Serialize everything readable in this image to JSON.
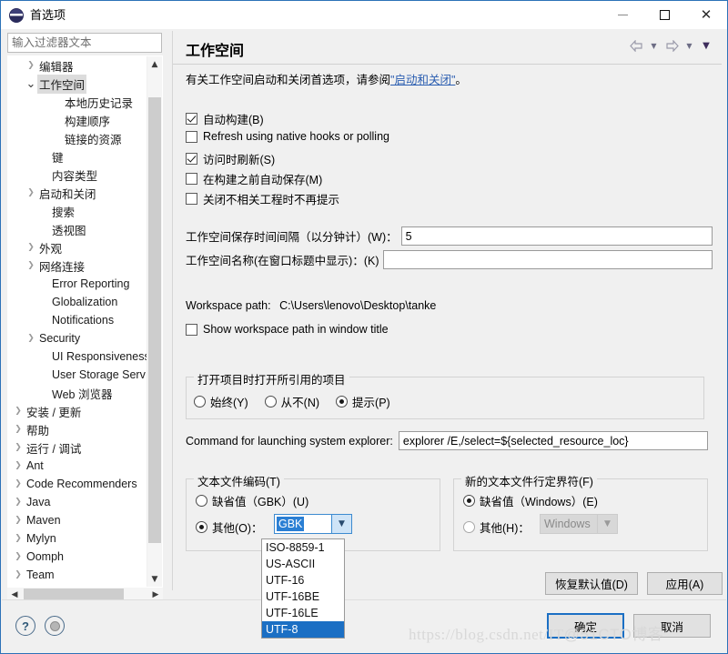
{
  "window": {
    "title": "首选项",
    "icon": "eclipse-icon",
    "controls": {
      "minimize": "—",
      "maximize": "□",
      "close": "✕"
    }
  },
  "sidebar": {
    "filter": {
      "placeholder": "输入过滤器文本",
      "value": ""
    },
    "items": [
      {
        "label": "编辑器",
        "indent": 1,
        "twisty": "collapsed",
        "selected": false
      },
      {
        "label": "工作空间",
        "indent": 1,
        "twisty": "expanded",
        "selected": true
      },
      {
        "label": "本地历史记录",
        "indent": 3,
        "twisty": "none",
        "selected": false
      },
      {
        "label": "构建顺序",
        "indent": 3,
        "twisty": "none",
        "selected": false
      },
      {
        "label": "链接的资源",
        "indent": 3,
        "twisty": "none",
        "selected": false
      },
      {
        "label": "键",
        "indent": 2,
        "twisty": "none",
        "selected": false
      },
      {
        "label": "内容类型",
        "indent": 2,
        "twisty": "none",
        "selected": false
      },
      {
        "label": "启动和关闭",
        "indent": 1,
        "twisty": "collapsed",
        "selected": false
      },
      {
        "label": "搜索",
        "indent": 2,
        "twisty": "none",
        "selected": false
      },
      {
        "label": "透视图",
        "indent": 2,
        "twisty": "none",
        "selected": false
      },
      {
        "label": "外观",
        "indent": 1,
        "twisty": "collapsed",
        "selected": false
      },
      {
        "label": "网络连接",
        "indent": 1,
        "twisty": "collapsed",
        "selected": false
      },
      {
        "label": "Error Reporting",
        "indent": 2,
        "twisty": "none",
        "selected": false
      },
      {
        "label": "Globalization",
        "indent": 2,
        "twisty": "none",
        "selected": false
      },
      {
        "label": "Notifications",
        "indent": 2,
        "twisty": "none",
        "selected": false
      },
      {
        "label": "Security",
        "indent": 1,
        "twisty": "collapsed",
        "selected": false
      },
      {
        "label": "UI Responsiveness",
        "indent": 2,
        "twisty": "none",
        "selected": false
      },
      {
        "label": "User Storage Serv",
        "indent": 2,
        "twisty": "none",
        "selected": false
      },
      {
        "label": "Web 浏览器",
        "indent": 2,
        "twisty": "none",
        "selected": false
      },
      {
        "label": "安装 / 更新",
        "indent": 0,
        "twisty": "collapsed",
        "selected": false
      },
      {
        "label": "帮助",
        "indent": 0,
        "twisty": "collapsed",
        "selected": false
      },
      {
        "label": "运行 / 调试",
        "indent": 0,
        "twisty": "collapsed",
        "selected": false
      },
      {
        "label": "Ant",
        "indent": 0,
        "twisty": "collapsed",
        "selected": false
      },
      {
        "label": "Code Recommenders",
        "indent": 0,
        "twisty": "collapsed",
        "selected": false
      },
      {
        "label": "Java",
        "indent": 0,
        "twisty": "collapsed",
        "selected": false
      },
      {
        "label": "Maven",
        "indent": 0,
        "twisty": "collapsed",
        "selected": false
      },
      {
        "label": "Mylyn",
        "indent": 0,
        "twisty": "collapsed",
        "selected": false
      },
      {
        "label": "Oomph",
        "indent": 0,
        "twisty": "collapsed",
        "selected": false
      },
      {
        "label": "Team",
        "indent": 0,
        "twisty": "collapsed",
        "selected": false
      }
    ]
  },
  "page": {
    "title": "工作空间",
    "description_pre": "有关工作空间启动和关闭首选项，请参阅",
    "description_link": "\"启动和关闭\"",
    "description_post": "。",
    "checkboxes": [
      {
        "label": "自动构建(B)",
        "checked": true
      },
      {
        "label": "Refresh using native hooks or polling",
        "checked": false
      },
      {
        "label": "访问时刷新(S)",
        "checked": true
      },
      {
        "label": "在构建之前自动保存(M)",
        "checked": false
      },
      {
        "label": "关闭不相关工程时不再提示",
        "checked": false
      }
    ],
    "fields": [
      {
        "label": "工作空间保存时间间隔（以分钟计）(W)：",
        "value": "5"
      },
      {
        "label": "工作空间名称(在窗口标题中显示)：(K)",
        "value": ""
      }
    ],
    "workspace_path_label": "Workspace path:",
    "workspace_path_value": "C:\\Users\\lenovo\\Desktop\\tanke",
    "show_path_checkbox": {
      "label": "Show workspace path in window title",
      "checked": false
    },
    "referenced_group": {
      "title": "打开项目时打开所引用的项目",
      "options": [
        {
          "label": "始终(Y)",
          "checked": false
        },
        {
          "label": "从不(N)",
          "checked": false
        },
        {
          "label": "提示(P)",
          "checked": true
        }
      ]
    },
    "explorer_command": {
      "label": "Command for launching system explorer:",
      "value": "explorer /E,/select=${selected_resource_loc}"
    },
    "encoding_group": {
      "title": "文本文件编码(T)",
      "default_option": {
        "label": "缺省值（GBK）(U)",
        "checked": false
      },
      "other_option": {
        "label": "其他(O)：",
        "checked": true
      },
      "combo_value": "GBK",
      "combo_open": true,
      "combo_options": [
        {
          "label": "ISO-8859-1",
          "selected": false
        },
        {
          "label": "US-ASCII",
          "selected": false
        },
        {
          "label": "UTF-16",
          "selected": false
        },
        {
          "label": "UTF-16BE",
          "selected": false
        },
        {
          "label": "UTF-16LE",
          "selected": false
        },
        {
          "label": "UTF-8",
          "selected": true
        }
      ]
    },
    "delimiter_group": {
      "title": "新的文本文件行定界符(F)",
      "default_option": {
        "label": "缺省值（Windows）(E)",
        "checked": true
      },
      "other_option": {
        "label": "其他(H)：",
        "checked": false
      },
      "combo_value": "Windows",
      "combo_disabled": true
    },
    "restore_defaults_button": "恢复默认值(D)",
    "apply_button": "应用(A)"
  },
  "footer": {
    "help_icon": "?",
    "ok_button": "确定",
    "cancel_button": "取消"
  },
  "watermark": {
    "url": "https://blog.csdn.net/IT",
    "suffix": "@51CTO博客"
  }
}
